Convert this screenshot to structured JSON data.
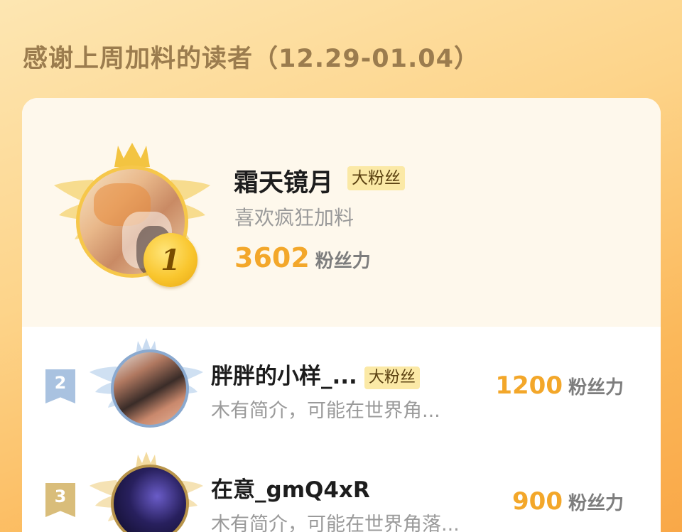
{
  "page": {
    "title": "感谢上周加料的读者（12.29-01.04）"
  },
  "top_fan": {
    "rank": "1",
    "name": "霜天镜月",
    "badge": "大粉丝",
    "bio": "喜欢疯狂加料",
    "score": "3602",
    "score_unit": "粉丝力"
  },
  "fans": [
    {
      "rank": "2",
      "name": "胖胖的小样_...",
      "badge": "大粉丝",
      "bio": "木有简介，可能在世界角...",
      "score": "1200",
      "score_unit": "粉丝力"
    },
    {
      "rank": "3",
      "name": "在意_gmQ4xR",
      "badge": "",
      "bio": "木有简介，可能在世界角落...",
      "score": "900",
      "score_unit": "粉丝力"
    }
  ],
  "colors": {
    "accent_score": "#f3a72a",
    "gold": "#f6c74a",
    "silver": "#9fb9d8",
    "bronze": "#d3b36b"
  },
  "icons": [
    "crown-icon",
    "laurel-wreath-icon",
    "rank-medal-icon",
    "rank-flag-icon"
  ]
}
